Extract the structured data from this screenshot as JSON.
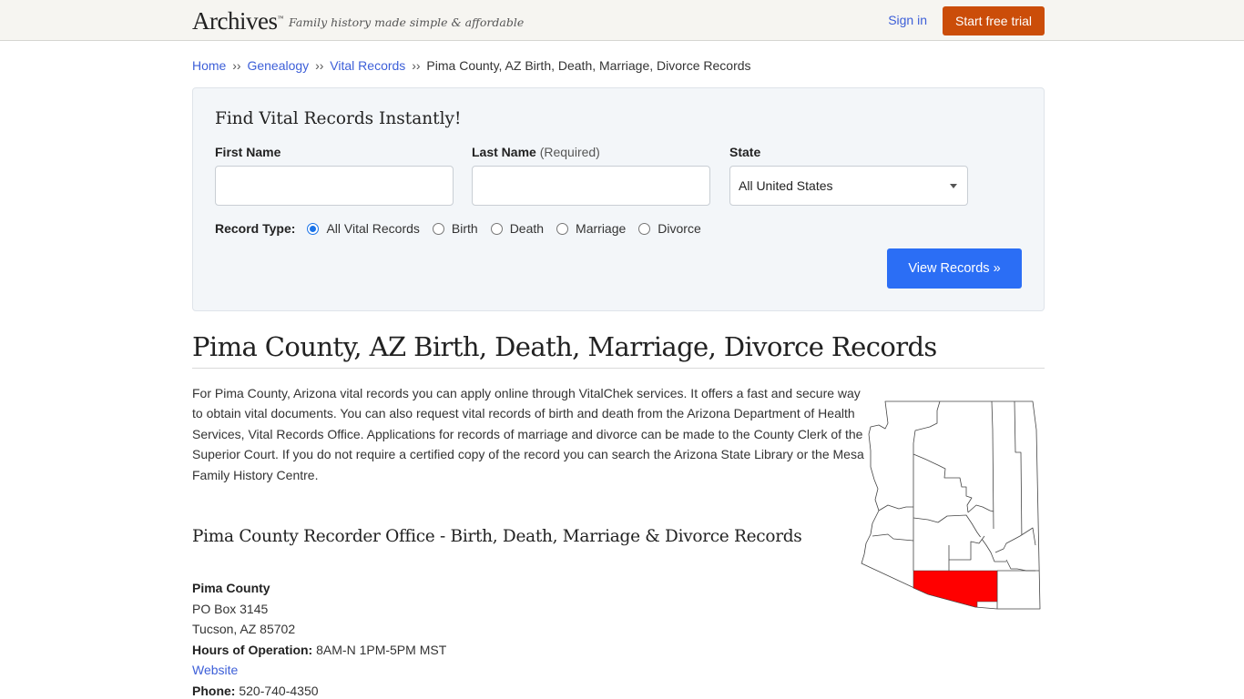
{
  "header": {
    "logo": "Archives",
    "logo_mark": "™",
    "tagline": "Family history made simple & affordable",
    "sign_in": "Sign in",
    "start_trial": "Start free trial"
  },
  "breadcrumb": {
    "items": [
      "Home",
      "Genealogy",
      "Vital Records"
    ],
    "separator": "››",
    "current": "Pima County, AZ Birth, Death, Marriage, Divorce Records"
  },
  "search": {
    "title": "Find Vital Records Instantly!",
    "first_name_label": "First Name",
    "first_name_value": "",
    "last_name_label": "Last Name",
    "last_name_required": "(Required)",
    "last_name_value": "",
    "state_label": "State",
    "state_selected": "All United States",
    "record_type_label": "Record Type:",
    "record_types": [
      {
        "label": "All Vital Records",
        "checked": true
      },
      {
        "label": "Birth",
        "checked": false
      },
      {
        "label": "Death",
        "checked": false
      },
      {
        "label": "Marriage",
        "checked": false
      },
      {
        "label": "Divorce",
        "checked": false
      }
    ],
    "submit": "View Records »"
  },
  "page": {
    "title": "Pima County, AZ Birth, Death, Marriage, Divorce Records",
    "intro": "For Pima County, Arizona vital records you can apply online through VitalChek services. It offers a fast and secure way to obtain vital documents. You can also request vital records of birth and death from the Arizona Department of Health Services, Vital Records Office. Applications for records of marriage and divorce can be made to the County Clerk of the Superior Court. If you do not require a certified copy of the record you can search the Arizona State Library or the Mesa Family History Centre.",
    "map": {
      "state": "Arizona",
      "highlighted_county": "Pima County",
      "highlight_color": "#ff0000"
    },
    "section_title": "Pima County Recorder Office - Birth, Death, Marriage & Divorce Records",
    "office": {
      "name": "Pima County",
      "address_line1": "PO Box 3145",
      "address_line2": "Tucson, AZ 85702",
      "hours_label": "Hours of Operation:",
      "hours": "8AM-N 1PM-5PM MST",
      "website_label": "Website",
      "phone_label": "Phone:",
      "phone": "520-740-4350"
    }
  },
  "colors": {
    "link": "#3d5fd8",
    "trial_button": "#cb4d09",
    "view_button": "#2b6ef5",
    "header_bg": "#f6f5f1",
    "panel_bg": "#f3f6f9"
  }
}
